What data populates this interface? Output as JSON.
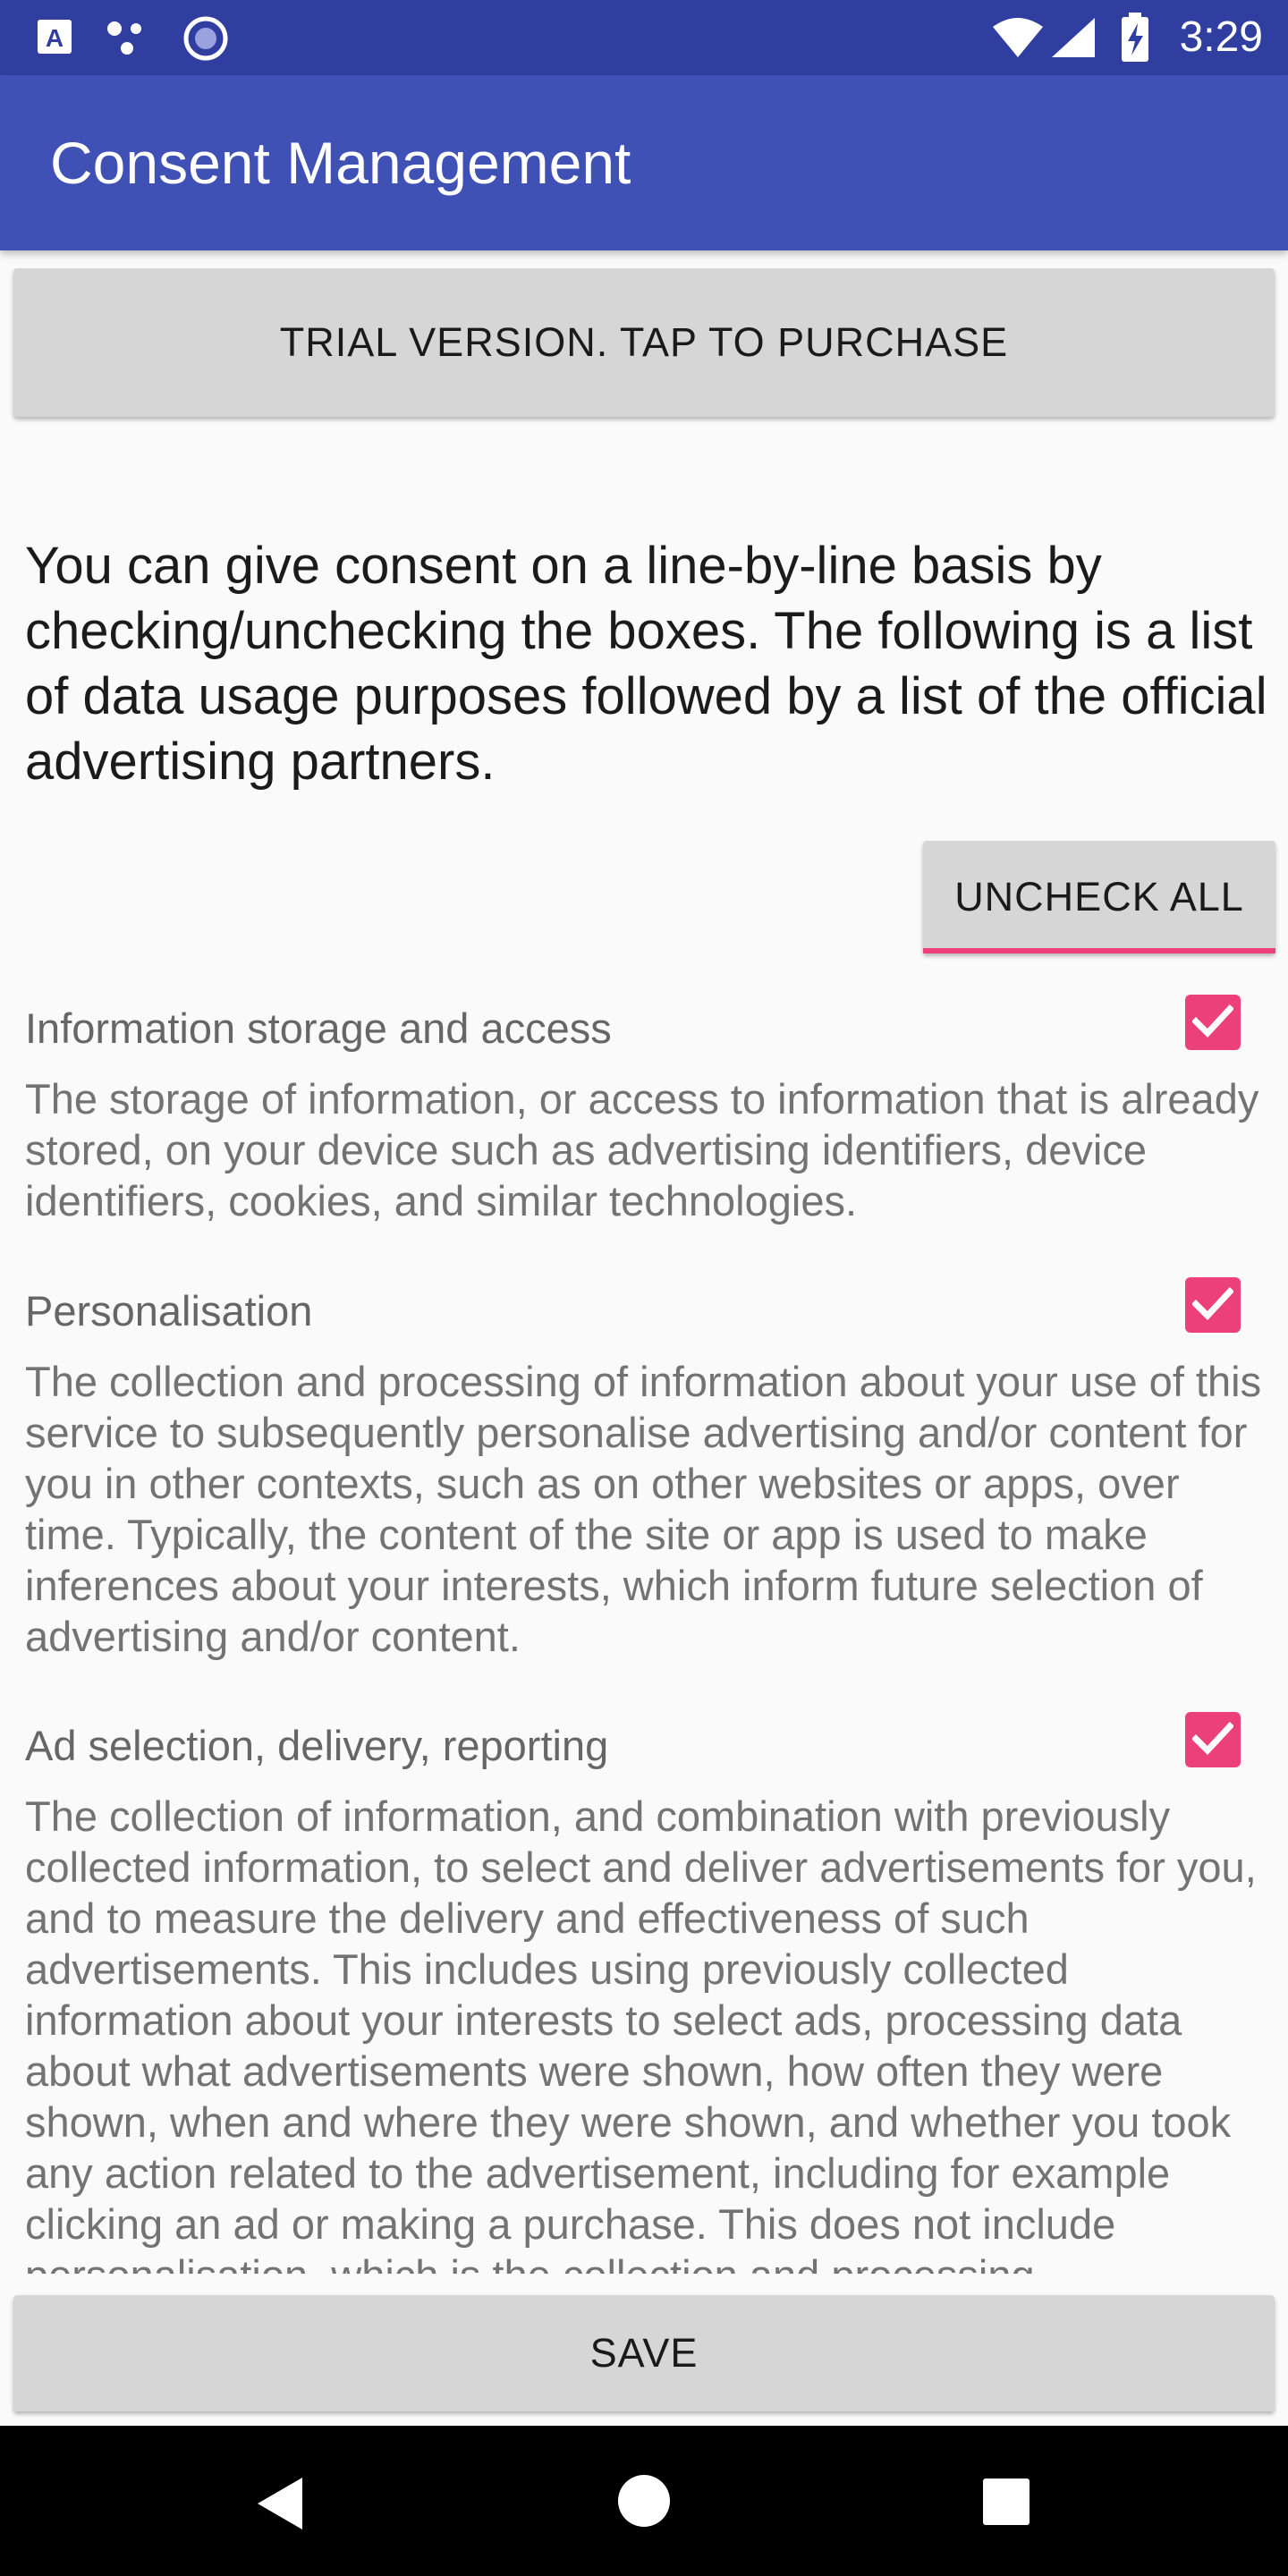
{
  "status_bar": {
    "time": "3:29",
    "icons": [
      "keyboard-a-icon",
      "dots-icon",
      "circle-record-icon",
      "wifi-icon",
      "signal-icon",
      "battery-charging-icon"
    ]
  },
  "app_bar": {
    "title": "Consent Management"
  },
  "trial_button": {
    "label": "TRIAL VERSION. TAP TO PURCHASE"
  },
  "intro_text": "You can give consent on a line-by-line basis by checking/unchecking the boxes. The following is a list of data usage purposes followed by a list of the official advertising partners.",
  "uncheck_all": {
    "label": "UNCHECK ALL"
  },
  "purposes": [
    {
      "title": "Information storage and access",
      "description": "The storage of information, or access to information that is already stored, on your device such as advertising identifiers, device identifiers, cookies, and similar technologies.",
      "checked": true
    },
    {
      "title": "Personalisation",
      "description": "The collection and processing of information about your use of this service to subsequently personalise advertising and/or content for you in other contexts, such as on other websites or apps, over time. Typically, the content of the site or app is used to make inferences about your interests, which inform future selection of advertising and/or content.",
      "checked": true
    },
    {
      "title": "Ad selection, delivery, reporting",
      "description": "The collection of information, and combination with previously collected information, to select and deliver advertisements for you, and to measure the delivery and effectiveness of such advertisements. This includes using previously collected information about your interests to select ads, processing data about what advertisements were shown, how often they were shown, when and where they were shown, and whether you took any action related to the advertisement, including for example clicking an ad or making a purchase. This does not include personalisation, which is the collection and processing",
      "checked": true
    }
  ],
  "save_button": {
    "label": "SAVE"
  },
  "nav_bar": {
    "icons": [
      "back-icon",
      "home-icon",
      "recents-icon"
    ]
  },
  "colors": {
    "status_bar": "#303f9f",
    "app_bar": "#3f51b5",
    "accent": "#ec407a"
  }
}
